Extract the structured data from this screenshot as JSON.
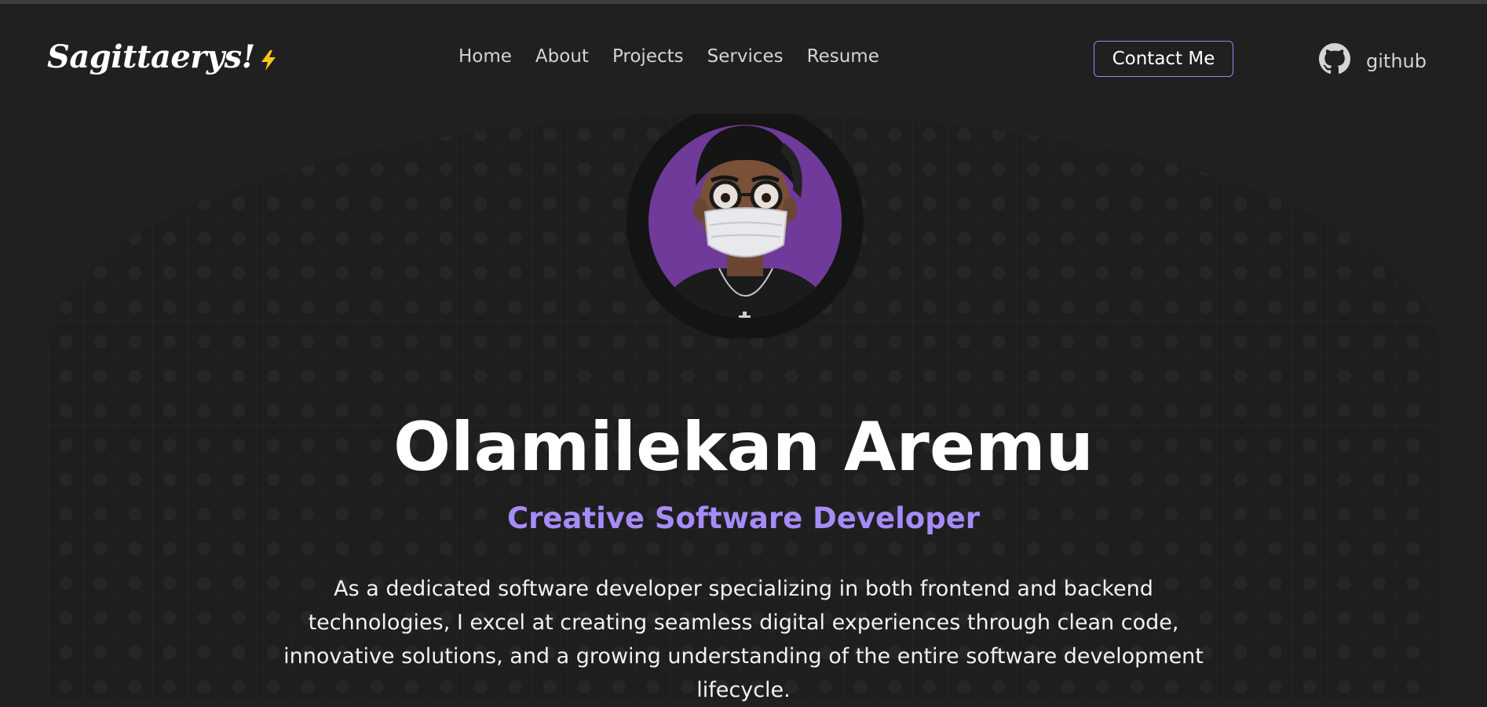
{
  "brand": {
    "logo_text": "Sagittaerys!",
    "logo_icon": "lightning-bolt-icon",
    "accent_color": "#a78bfa",
    "bolt_color": "#f5c518"
  },
  "nav": {
    "items": [
      {
        "label": "Home"
      },
      {
        "label": "About"
      },
      {
        "label": "Projects"
      },
      {
        "label": "Services"
      },
      {
        "label": "Resume"
      }
    ],
    "contact_label": "Contact Me",
    "github_label": "github",
    "github_icon": "github-icon"
  },
  "hero": {
    "avatar_icon": "profile-avatar",
    "name": "Olamilekan Aremu",
    "role": "Creative Software Developer",
    "bio": "As a dedicated software developer specializing in both frontend and backend technologies, I excel at creating seamless digital experiences through clean code, innovative solutions, and a growing understanding of the entire software development lifecycle."
  }
}
